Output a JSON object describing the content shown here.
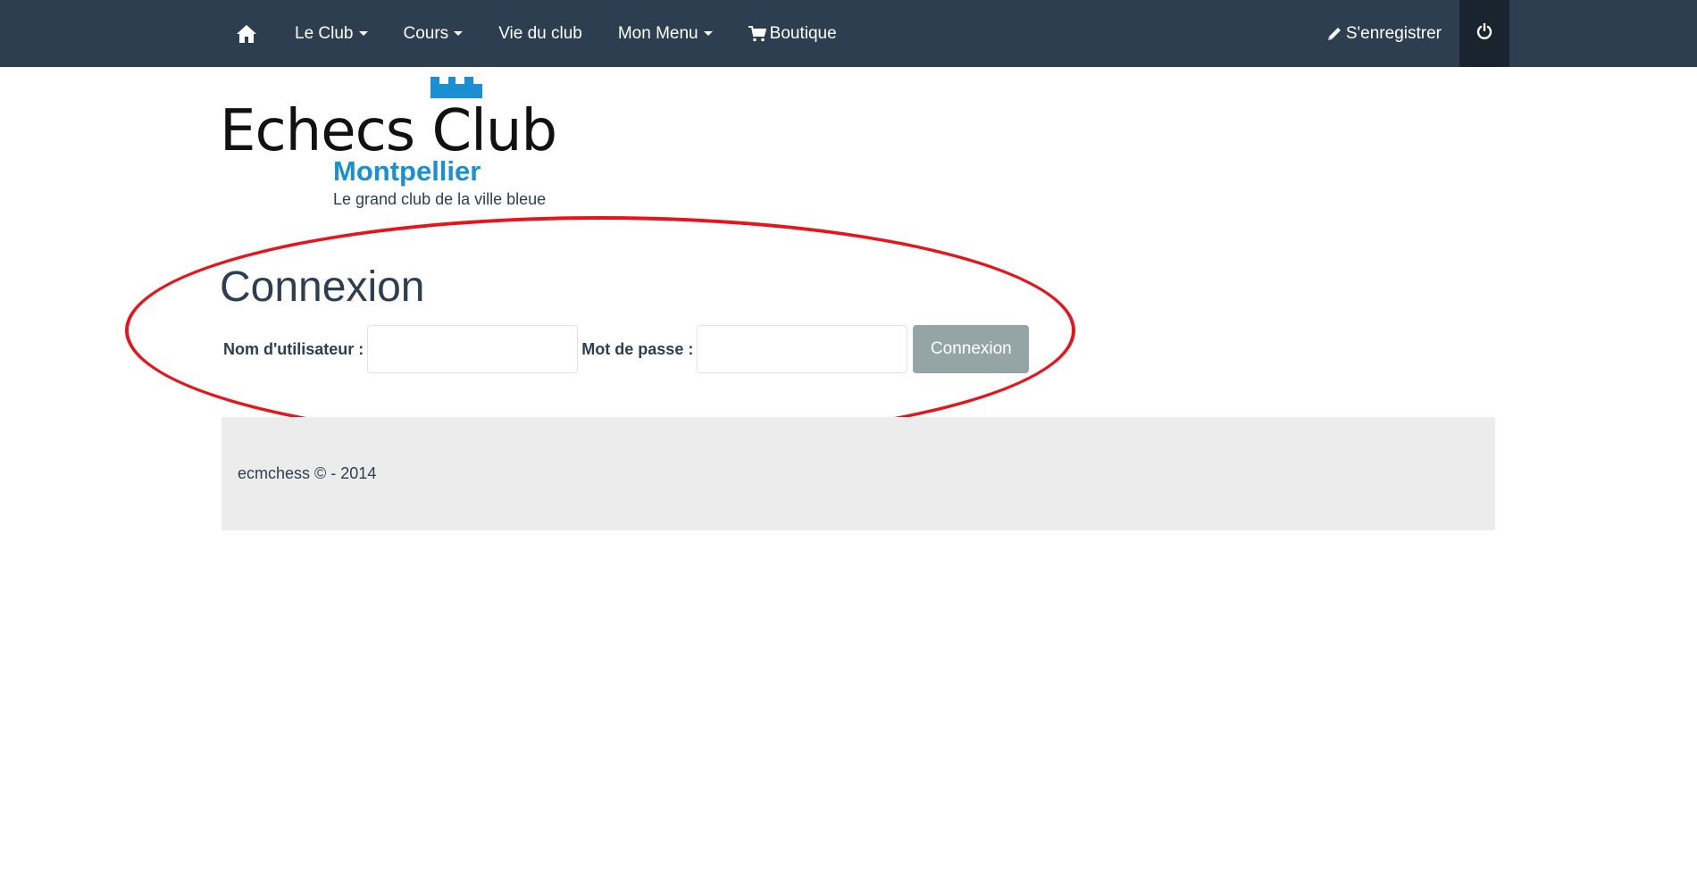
{
  "navbar": {
    "bg_color": "#2c3e50",
    "home_icon": "home-icon",
    "items": [
      {
        "label": "Le Club",
        "dropdown": true
      },
      {
        "label": "Cours",
        "dropdown": true
      },
      {
        "label": "Vie du club",
        "dropdown": false
      },
      {
        "label": "Mon Menu",
        "dropdown": true
      },
      {
        "label": "Boutique",
        "icon": "cart-icon"
      }
    ],
    "register_label": "S'enregistrer",
    "register_icon": "pencil-icon",
    "power_icon": "power-icon"
  },
  "logo": {
    "main": "Echecs Club",
    "city": "Montpellier",
    "tagline": "Le grand club de la ville bleue",
    "accent_color": "#1a8fd1"
  },
  "login": {
    "title": "Connexion",
    "username_label": "Nom d'utilisateur :",
    "username_value": "",
    "password_label": "Mot de passe :",
    "password_value": "",
    "submit_label": "Connexion",
    "button_color": "#95a5a6"
  },
  "annotation": {
    "highlight_color": "#e8141c"
  },
  "footer": {
    "text": "ecmchess © - 2014"
  }
}
